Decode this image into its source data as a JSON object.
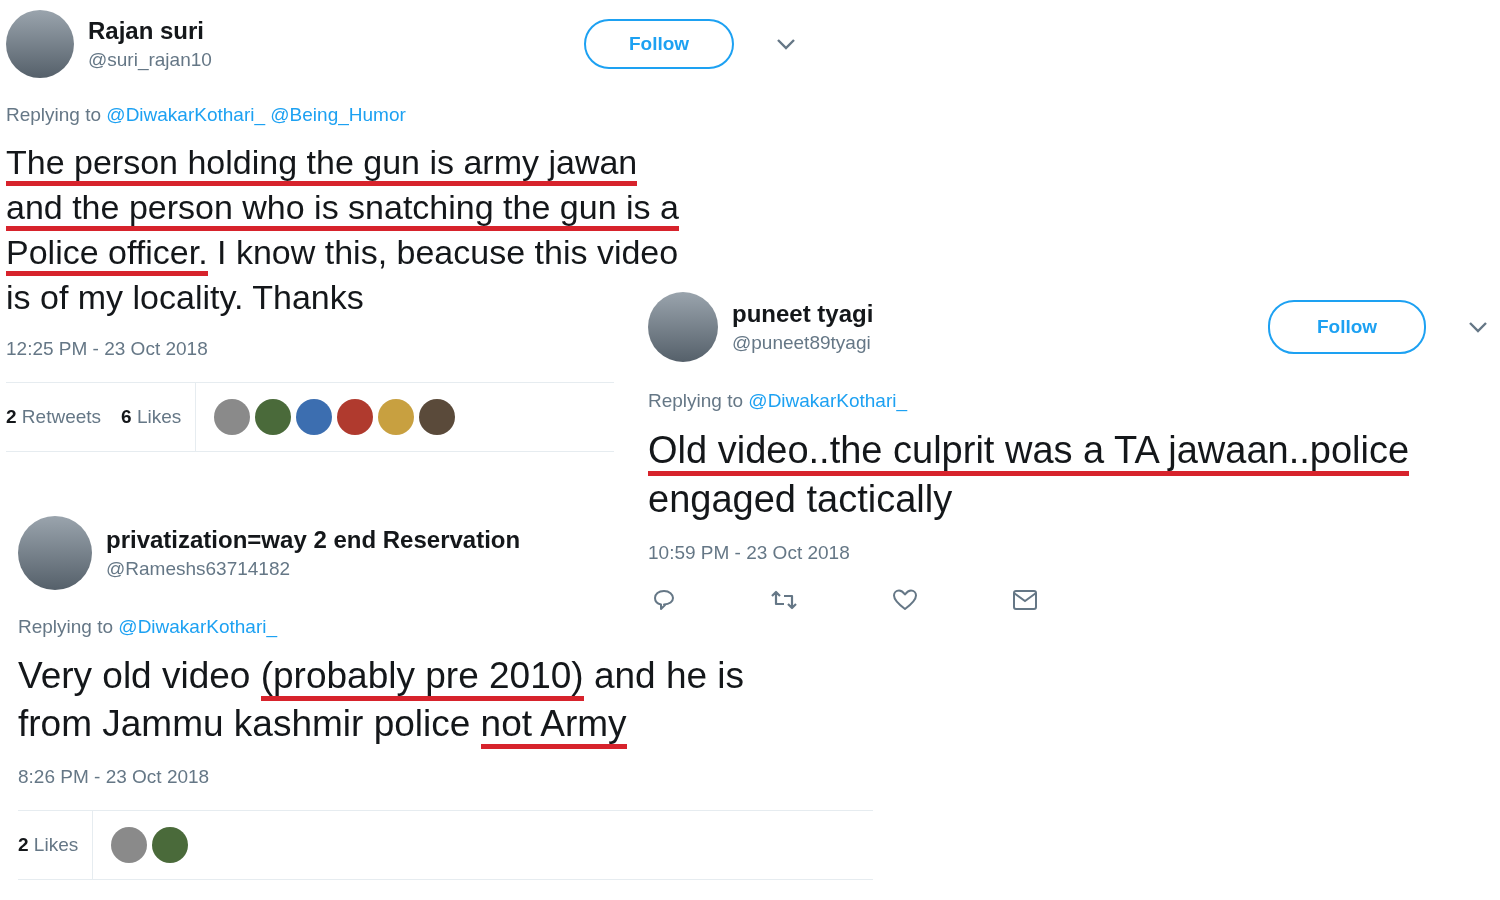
{
  "tweets": [
    {
      "name": "Rajan suri",
      "handle": "@suri_rajan10",
      "follow": "Follow",
      "replying_label": "Replying to",
      "replying_to": [
        "@DiwakarKothari_",
        "@Being_Humor"
      ],
      "text_lines": [
        [
          {
            "text": "The person holding the gun is army jawan",
            "underlined": true
          }
        ],
        [
          {
            "text": "and the person who is snatching the gun is a",
            "underlined": true
          }
        ],
        [
          {
            "text": "Police officer.",
            "underlined": true
          },
          {
            "text": " I know this, beacuse this video",
            "underlined": false
          }
        ],
        [
          {
            "text": "is of my locality. Thanks",
            "underlined": false
          }
        ]
      ],
      "time": "12:25 PM - 23 Oct 2018",
      "stats": [
        {
          "count": "2",
          "label": "Retweets"
        },
        {
          "count": "6",
          "label": "Likes"
        }
      ],
      "likers": [
        {
          "kind": "photo"
        },
        {
          "kind": "photo"
        },
        {
          "kind": "photo"
        },
        {
          "kind": "photo"
        },
        {
          "kind": "photo"
        },
        {
          "kind": "photo"
        }
      ]
    },
    {
      "name": "puneet tyagi",
      "handle": "@puneet89tyagi",
      "follow": "Follow",
      "replying_label": "Replying to",
      "replying_to": [
        "@DiwakarKothari_"
      ],
      "text_lines": [
        [
          {
            "text": "Old video..the culprit was a TA jawaan..police",
            "underlined": true
          }
        ],
        [
          {
            "text": "engaged tactically",
            "underlined": false
          }
        ]
      ],
      "time": "10:59 PM - 23 Oct 2018",
      "actions": [
        {
          "kind": "reply"
        },
        {
          "kind": "retweet"
        },
        {
          "kind": "like"
        },
        {
          "kind": "message"
        }
      ]
    },
    {
      "name": "privatization=way 2 end Reservation",
      "handle": "@Rameshs63714182",
      "replying_label": "Replying to",
      "replying_to": [
        "@DiwakarKothari_"
      ],
      "text_lines": [
        [
          {
            "text": "Very old video ",
            "underlined": false
          },
          {
            "text": "(probably pre 2010)",
            "underlined": true
          },
          {
            "text": " and he is",
            "underlined": false
          }
        ],
        [
          {
            "text": "from Jammu kashmir police ",
            "underlined": false
          },
          {
            "text": "not Army",
            "underlined": true
          }
        ]
      ],
      "time": "8:26 PM - 23 Oct 2018",
      "stats": [
        {
          "count": "2",
          "label": "Likes"
        }
      ],
      "likers": [
        {
          "kind": "photo"
        },
        {
          "kind": "photo"
        }
      ]
    }
  ]
}
